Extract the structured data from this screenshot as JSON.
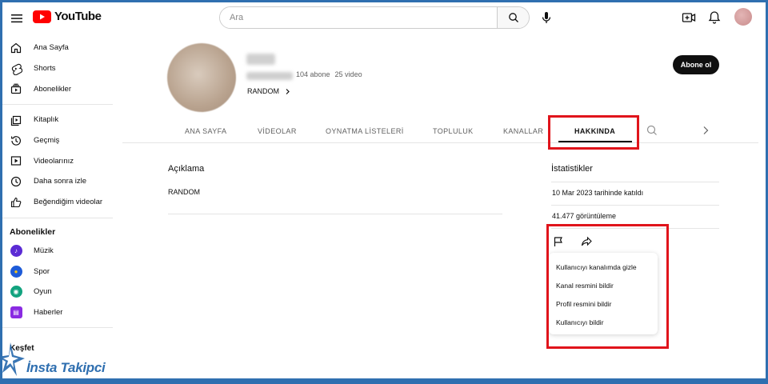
{
  "app": {
    "logo_text": "YouTube",
    "brand_color": "#ff0000"
  },
  "search": {
    "placeholder": "Ara",
    "value": ""
  },
  "icons": {
    "menu": "menu-icon",
    "search": "search-icon",
    "mic": "mic-icon",
    "create": "create-video-icon",
    "notifications": "bell-icon"
  },
  "sidebar": {
    "items": [
      {
        "label": "Ana Sayfa",
        "icon": "home-icon"
      },
      {
        "label": "Shorts",
        "icon": "shorts-icon"
      },
      {
        "label": "Abonelikler",
        "icon": "subscriptions-icon"
      }
    ],
    "library_items": [
      {
        "label": "Kitaplık",
        "icon": "library-icon"
      },
      {
        "label": "Geçmiş",
        "icon": "history-icon"
      },
      {
        "label": "Videolarınız",
        "icon": "your-videos-icon"
      },
      {
        "label": "Daha sonra izle",
        "icon": "watch-later-icon"
      },
      {
        "label": "Beğendiğim videolar",
        "icon": "liked-icon"
      }
    ],
    "subscriptions_heading": "Abonelikler",
    "subscriptions": [
      {
        "label": "Müzik",
        "color": "#5b2bd4"
      },
      {
        "label": "Spor",
        "color": "#1e5bd8"
      },
      {
        "label": "Oyun",
        "color": "#12a37f"
      },
      {
        "label": "Haberler",
        "color": "#8a2be2"
      }
    ],
    "explore_heading": "Keşfet"
  },
  "channel": {
    "subscribers": "104 abone",
    "videos": "25 video",
    "more_label": "RANDOM",
    "subscribe_label": "Abone ol"
  },
  "tabs": [
    {
      "label": "ANA SAYFA",
      "active": false
    },
    {
      "label": "VİDEOLAR",
      "active": false
    },
    {
      "label": "OYNATMA LİSTELERİ",
      "active": false
    },
    {
      "label": "TOPLULUK",
      "active": false
    },
    {
      "label": "KANALLAR",
      "active": false
    },
    {
      "label": "HAKKINDA",
      "active": true
    }
  ],
  "about": {
    "description_title": "Açıklama",
    "description_text": "RANDOM",
    "stats_title": "İstatistikler",
    "joined": "10 Mar 2023 tarihinde katıldı",
    "views": "41.477 görüntüleme"
  },
  "report_menu": {
    "items": [
      "Kullanıcıyı kanalımda gizle",
      "Kanal resmini bildir",
      "Profil resmini bildir",
      "Kullanıcıyı bildir"
    ]
  },
  "highlight_color": "#e0141b",
  "watermark": {
    "text": "İnsta Takipci"
  }
}
